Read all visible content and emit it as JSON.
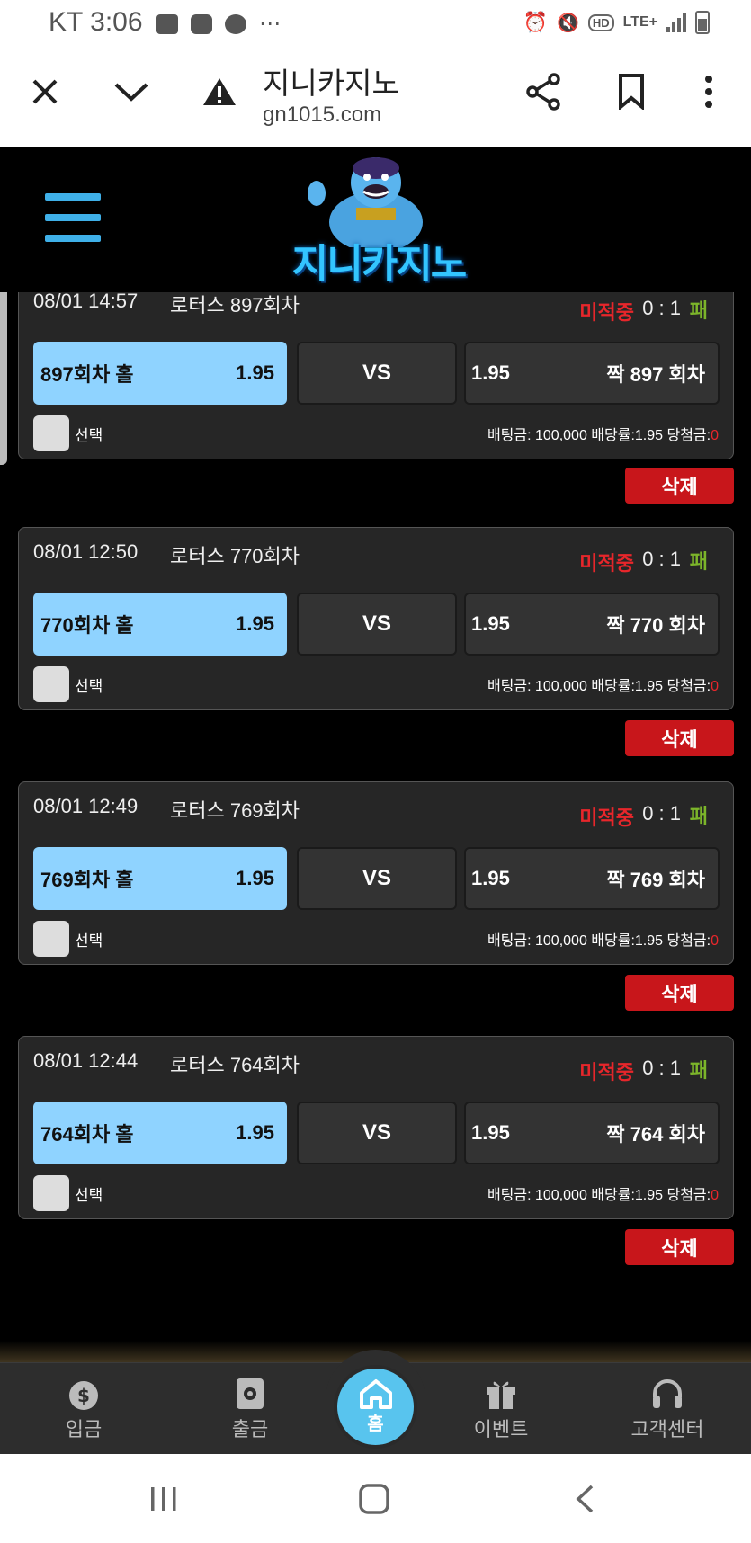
{
  "status_bar": {
    "time": "KT 3:06",
    "icons": [
      "image-icon",
      "youtube-icon",
      "chrome-icon",
      "more-icon"
    ],
    "right_icons": [
      "alarm-icon",
      "mute-icon",
      "hd-icon",
      "lte-icon",
      "signal-icon",
      "battery-icon"
    ],
    "hd": "HD",
    "lte": "LTE+"
  },
  "browser": {
    "title": "지니카지노",
    "url": "gn1015.com"
  },
  "header": {
    "logo_text": "지니카지노"
  },
  "colors": {
    "accent_blue": "#8fd3ff",
    "status_red": "#e8262b",
    "result_green": "#7cb52a",
    "delete_red": "#c8161b"
  },
  "bets": [
    {
      "datetime": "08/01 14:57",
      "game": "로터스 897회차",
      "status": "미적중",
      "score": "0 : 1",
      "result": "패",
      "home_label": "897회차 홀",
      "home_odds": "1.95",
      "vs": "VS",
      "away_odds": "1.95",
      "away_label": "짝 897 회차",
      "select_label": "선택",
      "bet_info": "배팅금: 100,000 배당률:1.95 당첨금:",
      "win_amount": "0",
      "delete_label": "삭제"
    },
    {
      "datetime": "08/01 12:50",
      "game": "로터스 770회차",
      "status": "미적중",
      "score": "0 : 1",
      "result": "패",
      "home_label": "770회차 홀",
      "home_odds": "1.95",
      "vs": "VS",
      "away_odds": "1.95",
      "away_label": "짝 770 회차",
      "select_label": "선택",
      "bet_info": "배팅금: 100,000 배당률:1.95 당첨금:",
      "win_amount": "0",
      "delete_label": "삭제"
    },
    {
      "datetime": "08/01 12:49",
      "game": "로터스 769회차",
      "status": "미적중",
      "score": "0 : 1",
      "result": "패",
      "home_label": "769회차 홀",
      "home_odds": "1.95",
      "vs": "VS",
      "away_odds": "1.95",
      "away_label": "짝 769 회차",
      "select_label": "선택",
      "bet_info": "배팅금: 100,000 배당률:1.95 당첨금:",
      "win_amount": "0",
      "delete_label": "삭제"
    },
    {
      "datetime": "08/01 12:44",
      "game": "로터스 764회차",
      "status": "미적중",
      "score": "0 : 1",
      "result": "패",
      "home_label": "764회차 홀",
      "home_odds": "1.95",
      "vs": "VS",
      "away_odds": "1.95",
      "away_label": "짝 764 회차",
      "select_label": "선택",
      "bet_info": "배팅금: 100,000 배당률:1.95 당첨금:",
      "win_amount": "0",
      "delete_label": "삭제"
    }
  ],
  "bottom_nav": {
    "deposit": "입금",
    "withdraw": "출금",
    "home": "홈",
    "event": "이벤트",
    "support": "고객센터"
  }
}
